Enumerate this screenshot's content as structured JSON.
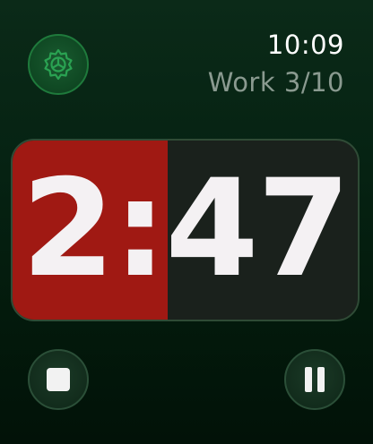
{
  "header": {
    "time": "10:09",
    "session_label": "Work 3/10"
  },
  "timer": {
    "remaining_display": "2:47",
    "elapsed_fraction": 0.45,
    "elapsed_color": "#a01913",
    "remaining_color": "#1a211c"
  },
  "controls": {
    "settings_icon": "gear-icon",
    "stop_icon": "stop-icon",
    "pause_icon": "pause-icon"
  },
  "colors": {
    "accent": "#1f7a3c",
    "background": "#062313",
    "secondary_text": "#8a9a90"
  }
}
